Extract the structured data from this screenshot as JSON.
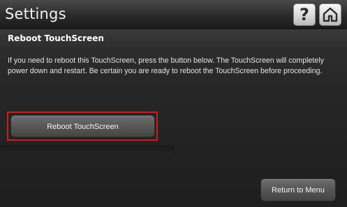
{
  "header": {
    "title": "Settings",
    "help_icon": "question-mark-icon",
    "home_icon": "home-icon"
  },
  "section": {
    "title": "Reboot TouchScreen",
    "description": "If you need to reboot this TouchScreen, press the button below. The TouchScreen will completely power down and restart.  Be certain you are ready to reboot the TouchScreen before proceeding."
  },
  "actions": {
    "reboot_label": "Reboot TouchScreen",
    "return_label": "Return to Menu"
  },
  "colors": {
    "highlight": "#d11a1a",
    "background": "#262626",
    "button": "#5a5a5a",
    "text": "#ffffff"
  }
}
